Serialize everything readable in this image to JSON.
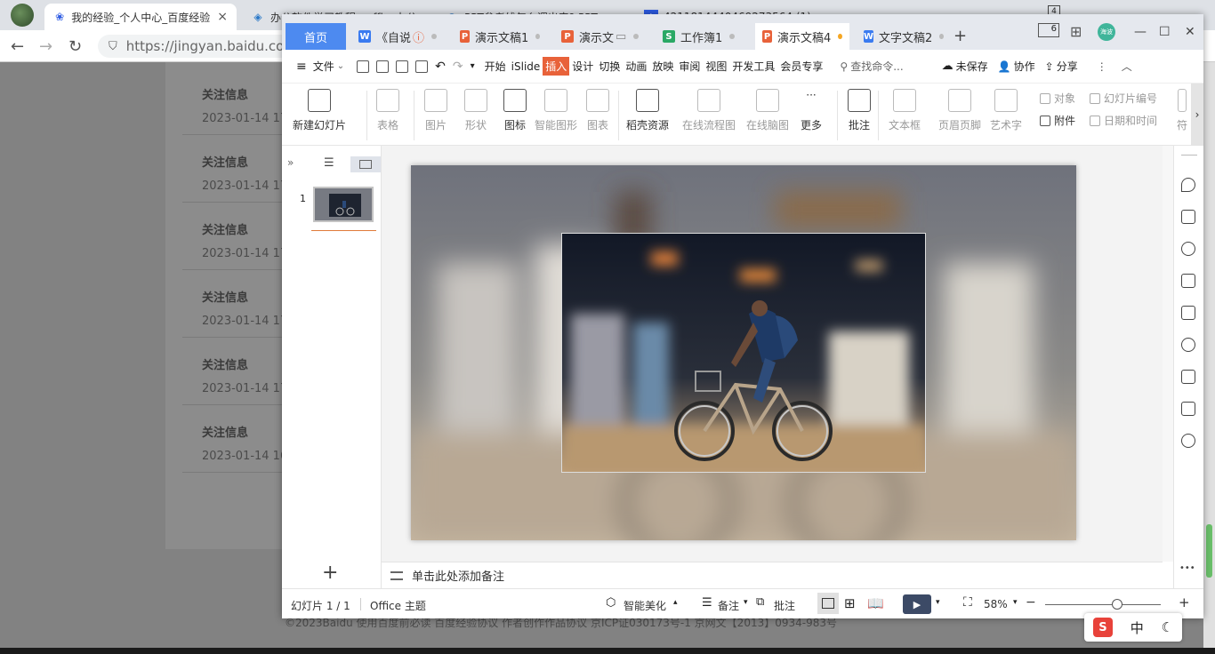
{
  "browser": {
    "tabs": [
      {
        "label": "我的经验_个人中心_百度经验",
        "icon": "baidu-paw-icon"
      },
      {
        "label": "办公软件学习教程 - office办公",
        "icon": "edu-icon"
      },
      {
        "label": "PPT参考线怎么调出来? PPT",
        "icon": "edge-icon"
      },
      {
        "label": "4211814440469273564 (1)",
        "icon": "doc-icon"
      }
    ],
    "tab_count": "4",
    "url": "https://jingyan.baidu.com",
    "close": "×"
  },
  "page": {
    "follow_items": [
      {
        "title": "关注信息",
        "date": "2023-01-14 17"
      },
      {
        "title": "关注信息",
        "date": "2023-01-14 17"
      },
      {
        "title": "关注信息",
        "date": "2023-01-14 17"
      },
      {
        "title": "关注信息",
        "date": "2023-01-14 17"
      },
      {
        "title": "关注信息",
        "date": "2023-01-14 17"
      },
      {
        "title": "关注信息",
        "date": "2023-01-14 16"
      }
    ],
    "footer": "©2023Baidu  使用百度前必读  百度经验协议  作者创作作品协议  京ICP证030173号-1 京网文【2013】0934-983号"
  },
  "wps": {
    "home_tab": "首页",
    "doc_tabs": [
      {
        "label": "《自说",
        "type": "w"
      },
      {
        "label": "演示文稿1",
        "type": "p"
      },
      {
        "label": "演示文",
        "type": "p"
      },
      {
        "label": "工作簿1",
        "type": "s"
      },
      {
        "label": "演示文稿4",
        "type": "p",
        "active": true
      },
      {
        "label": "文字文稿2",
        "type": "w"
      }
    ],
    "file_type_letters": {
      "w": "W",
      "p": "P",
      "s": "S"
    },
    "add_tab": "+",
    "window_badge": "6",
    "user_badge": "海波",
    "menu": {
      "file": "文件",
      "tabs": [
        "开始",
        "iSlide",
        "插入",
        "设计",
        "切换",
        "动画",
        "放映",
        "审阅",
        "视图",
        "开发工具",
        "会员专享"
      ],
      "active_tab": "插入",
      "search": "查找命令...",
      "unsaved": "未保存",
      "collab": "协作",
      "share": "分享"
    },
    "ribbon": {
      "buttons": [
        {
          "label": "新建幻灯片",
          "dropdown": true,
          "enabled": true
        },
        {
          "label": "表格",
          "dropdown": true,
          "enabled": false
        },
        {
          "label": "图片",
          "dropdown": true,
          "enabled": false
        },
        {
          "label": "形状",
          "dropdown": true,
          "enabled": false
        },
        {
          "label": "图标",
          "dropdown": false,
          "enabled": true
        },
        {
          "label": "智能图形",
          "dropdown": false,
          "enabled": false
        },
        {
          "label": "图表",
          "dropdown": false,
          "enabled": false
        },
        {
          "label": "稻壳资源",
          "dropdown": false,
          "enabled": true
        },
        {
          "label": "在线流程图",
          "dropdown": false,
          "enabled": false
        },
        {
          "label": "在线脑图",
          "dropdown": false,
          "enabled": false
        },
        {
          "label": "更多",
          "dropdown": true,
          "enabled": true
        },
        {
          "label": "批注",
          "dropdown": false,
          "enabled": true
        },
        {
          "label": "文本框",
          "dropdown": true,
          "enabled": false
        },
        {
          "label": "页眉页脚",
          "dropdown": false,
          "enabled": false
        },
        {
          "label": "艺术字",
          "dropdown": true,
          "enabled": false
        },
        {
          "label": "符",
          "dropdown": false,
          "enabled": false
        }
      ],
      "small": {
        "object": "对象",
        "attachment": "附件",
        "slide_number": "幻灯片编号",
        "datetime": "日期和时间"
      }
    },
    "slide_panel": {
      "slide_index": "1",
      "add": "+"
    },
    "notes_placeholder": "单击此处添加备注",
    "status": {
      "slide_info": "幻灯片 1 / 1",
      "theme": "Office 主题",
      "beautify": "智能美化",
      "notes": "备注",
      "comments": "批注",
      "zoom": "58%",
      "minus": "−",
      "plus": "+",
      "zoom_level": 0.62
    },
    "more_dots": "•••"
  },
  "ime": {
    "logo": "S",
    "mode": "中",
    "moon": "☾"
  },
  "colors": {
    "accent_home": "#4d8af0",
    "active_menu": "#e8623a",
    "ppt": "#e8623a",
    "word": "#3a7bf0",
    "sheet": "#2aa865"
  }
}
